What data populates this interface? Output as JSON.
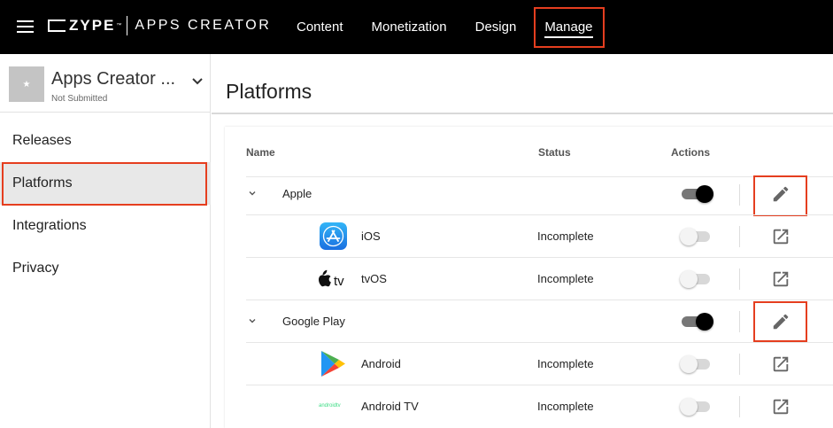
{
  "topbar": {
    "brand": "ZYPE",
    "brand_tm": "™",
    "product": "APPS CREATOR",
    "nav": [
      {
        "label": "Content"
      },
      {
        "label": "Monetization"
      },
      {
        "label": "Design"
      },
      {
        "label": "Manage"
      }
    ],
    "active_nav": "Manage"
  },
  "sidebar": {
    "app_title": "Apps Creator ...",
    "app_status": "Not Submitted",
    "items": [
      {
        "label": "Releases"
      },
      {
        "label": "Platforms"
      },
      {
        "label": "Integrations"
      },
      {
        "label": "Privacy"
      }
    ],
    "selected": "Platforms"
  },
  "main": {
    "title": "Platforms",
    "columns": {
      "name": "Name",
      "status": "Status",
      "actions": "Actions"
    },
    "groups": [
      {
        "name": "Apple",
        "enabled": true,
        "items": [
          {
            "name": "iOS",
            "status": "Incomplete",
            "enabled": false,
            "logo": "app-store-icon"
          },
          {
            "name": "tvOS",
            "status": "Incomplete",
            "enabled": false,
            "logo": "apple-tv-icon"
          }
        ]
      },
      {
        "name": "Google Play",
        "enabled": true,
        "items": [
          {
            "name": "Android",
            "status": "Incomplete",
            "enabled": false,
            "logo": "google-play-icon"
          },
          {
            "name": "Android TV",
            "status": "Incomplete",
            "enabled": false,
            "logo": "android-tv-icon",
            "logo_text": "androidtv"
          }
        ]
      }
    ]
  },
  "colors": {
    "topbar_bg": "#000000",
    "highlight": "#e53e1f",
    "selected_bg": "#e8e8e8",
    "android_tv_green": "#3ddc84"
  }
}
